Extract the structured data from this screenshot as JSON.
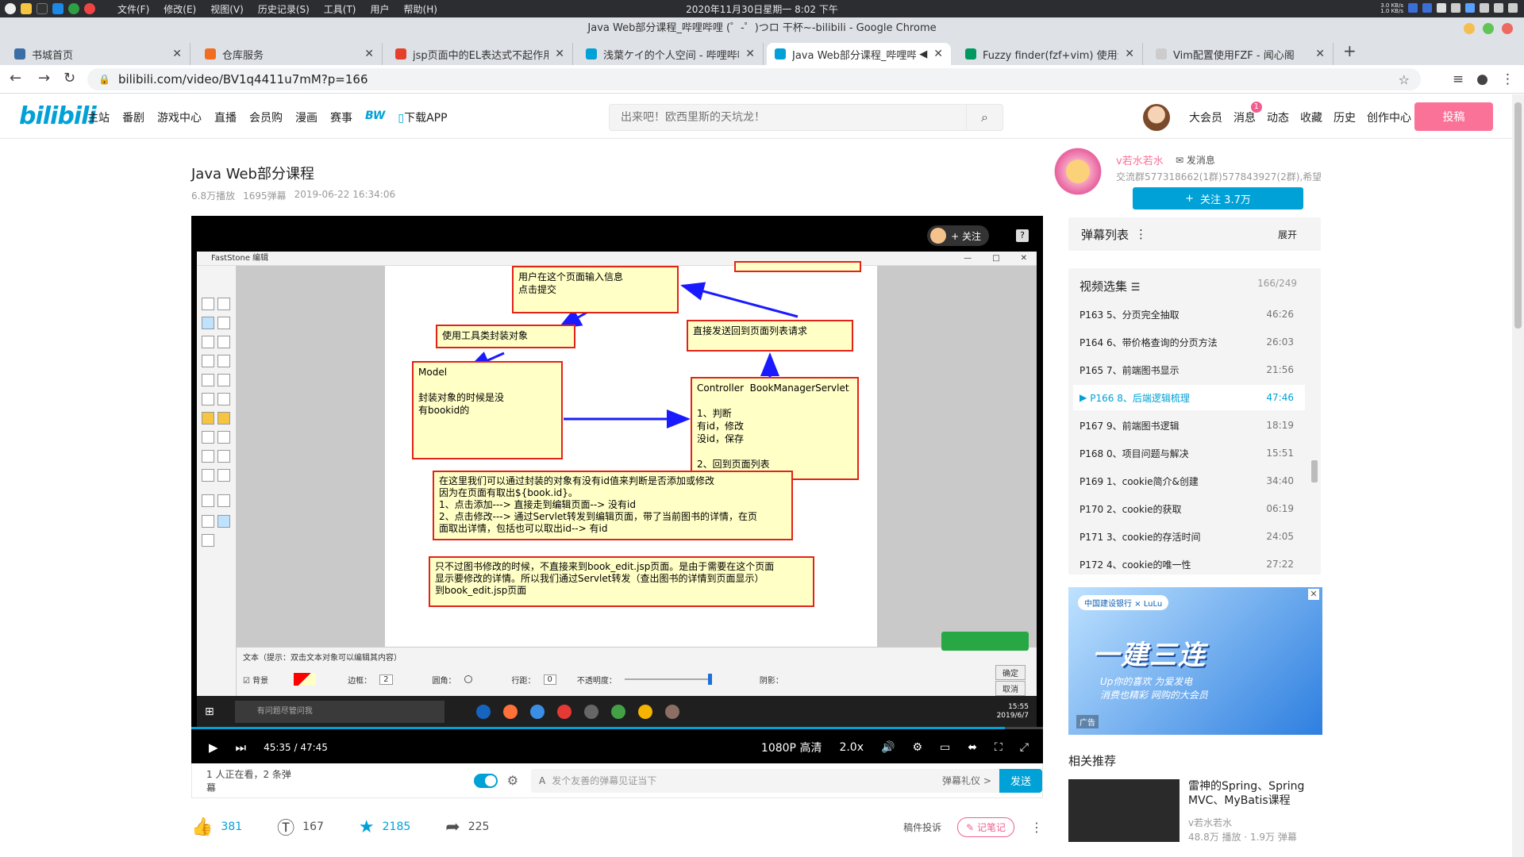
{
  "os": {
    "menu": [
      "文件(F)",
      "修改(E)",
      "视图(V)",
      "历史记录(S)",
      "工具(T)",
      "用户",
      "帮助(H)"
    ],
    "clock": "2020年11月30日星期一   8:02 下午",
    "net_up": "3.0 KB/s",
    "net_down": "1.0 KB/s"
  },
  "window": {
    "title": "Java Web部分课程_哔哩哔哩 (゜-゜)つロ 干杯~-bilibili - Google Chrome"
  },
  "tabs": [
    {
      "title": "书城首页",
      "color": "#3a6ea5"
    },
    {
      "title": "仓库服务",
      "color": "#f36d21"
    },
    {
      "title": "jsp页面中的EL表达式不起作用",
      "color": "#e4402a"
    },
    {
      "title": "浅葉ケイ的个人空间 - 哔哩哔哩",
      "color": "#00a1d6"
    },
    {
      "title": "Java Web部分课程_哔哩哔",
      "color": "#00a1d6"
    },
    {
      "title": "Fuzzy finder(fzf+vim) 使用全指",
      "color": "#009a61"
    },
    {
      "title": "Vim配置使用FZF - 闻心阁",
      "color": "#cccccc"
    }
  ],
  "address": {
    "url": "bilibili.com/video/BV1q4411u7mM?p=166"
  },
  "bili": {
    "logo": "bilibili",
    "nav": [
      "主站",
      "番剧",
      "游戏中心",
      "直播",
      "会员购",
      "漫画",
      "赛事",
      "BW",
      "下载APP"
    ],
    "search_placeholder": "出来吧！欧西里斯的天坑龙！",
    "user_nav": {
      "vip": "大会员",
      "msg": "消息",
      "msg_badge": "1",
      "dynamic": "动态",
      "fav": "收藏",
      "history": "历史",
      "creator": "创作中心"
    },
    "upload": "投稿"
  },
  "video": {
    "title": "Java Web部分课程",
    "plays": "6.8万播放",
    "danmaku": "1695弹幕",
    "date": "2019-06-22 16:34:06",
    "follow_label": "关注",
    "time_current": "45:35",
    "time_total": "47:45",
    "progress": 0.955,
    "quality": "1080P 高清",
    "speed": "2.0x"
  },
  "screen": {
    "app_title": "FastStone 编辑",
    "boxes": [
      {
        "text": "用户在这个页面输入信息\n点击提交"
      },
      {
        "text": "使用工具类封装对象"
      },
      {
        "text": "直接发送回到页面列表请求"
      },
      {
        "text": "Model\n\n封装对象的时候是没\n有bookid的"
      },
      {
        "text": "Controller  BookManagerServlet\n\n1、判断\n有id，修改\n没id，保存\n\n2、回到页面列表"
      },
      {
        "text": "在这里我们可以通过封装的对象有没有id值来判断是否添加或修改\n因为在页面有取出${book.id}。\n1、点击添加---> 直接走到编辑页面--> 没有id\n2、点击修改---> 通过Servlet转发到编辑页面，带了当前图书的详情，在页\n面取出详情，包括也可以取出id--> 有id"
      },
      {
        "text": "只不过图书修改的时候，不直接来到book_edit.jsp页面。是由于需要在这个页面\n显示要修改的详情。所以我们通过Servlet转发（查出图书的详情到页面显示）\n到book_edit.jsp页面"
      }
    ],
    "hint": "文本（提示：双击文本对象可以编辑其内容）",
    "props": {
      "bg": "背景",
      "border": "边框：",
      "border_val": "2",
      "corner": "圆角：",
      "line": "行距：",
      "line_val": "0",
      "opacity": "不透明度：",
      "shadow": "阴影：",
      "ok": "确定",
      "cancel": "取消"
    },
    "taskbar_search": "有问题尽管问我",
    "sys_time": "15:55",
    "sys_date": "2019/6/7"
  },
  "danmaku_bar": {
    "watching": "1 人正在看，2 条弹幕",
    "placeholder": "发个友善的弹幕见证当下",
    "etiquette": "弹幕礼仪 >",
    "send": "发送"
  },
  "actions": {
    "like": "381",
    "coin": "167",
    "fav": "2185",
    "share": "225",
    "report": "稿件投诉",
    "note": "记笔记"
  },
  "uploader": {
    "name": "v若水若水",
    "msg": "发消息",
    "desc": "交流群577318662(1群)577843927(2群),希望...",
    "follow": "关注 3.7万"
  },
  "danmaku_list": {
    "title": "弹幕列表",
    "expand": "展开"
  },
  "episodes": {
    "title": "视频选集",
    "count": "166/249",
    "items": [
      {
        "label": "P163  5、分页完全抽取",
        "dur": "46:26"
      },
      {
        "label": "P164  6、带价格查询的分页方法",
        "dur": "26:03"
      },
      {
        "label": "P165  7、前端图书显示",
        "dur": "21:56"
      },
      {
        "label": "P166  8、后端逻辑梳理",
        "dur": "47:46"
      },
      {
        "label": "P167  9、前端图书逻辑",
        "dur": "18:19"
      },
      {
        "label": "P168  0、项目问题与解决",
        "dur": "15:51"
      },
      {
        "label": "P169  1、cookie简介&创建",
        "dur": "34:40"
      },
      {
        "label": "P170  2、cookie的获取",
        "dur": "06:19"
      },
      {
        "label": "P171  3、cookie的存活时间",
        "dur": "24:05"
      },
      {
        "label": "P172  4、cookie的唯一性",
        "dur": "27:22"
      }
    ]
  },
  "ad": {
    "brand": "中国建设银行 × LuLu",
    "headline": "一建三连",
    "sub": "Up你的喜欢  为爱发电",
    "sub2": "消费也精彩 网购的大会员",
    "tag": "广告"
  },
  "recommend": {
    "title": "相关推荐",
    "items": [
      {
        "title": "雷神的Spring、Spring MVC、MyBatis课程",
        "author": "v若水若水",
        "stats": "48.8万 播放 · 1.9万 弹幕"
      }
    ]
  }
}
